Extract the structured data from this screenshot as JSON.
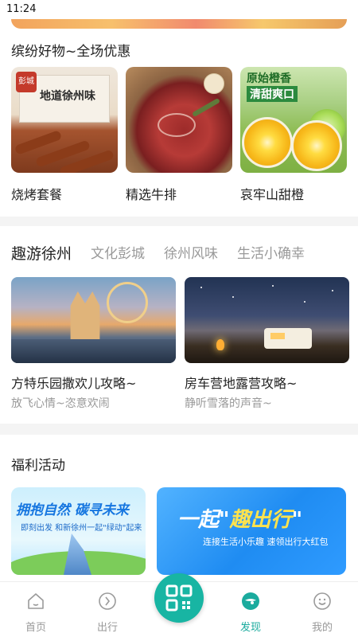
{
  "status_bar": {
    "time": "11:24"
  },
  "goods": {
    "title": "缤纷好物~全场优惠",
    "items": [
      {
        "name": "烧烤套餐",
        "image_text": "地道徐州味",
        "stamp": "彭城"
      },
      {
        "name": "精选牛排"
      },
      {
        "name": "哀牢山甜橙",
        "image_title": "原始橙香",
        "image_sub": "清甜爽口"
      }
    ]
  },
  "tour": {
    "tabs": [
      "趣游徐州",
      "文化彭城",
      "徐州风味",
      "生活小确幸"
    ],
    "active_tab": 0,
    "cards": [
      {
        "title": "方特乐园撒欢儿攻略~",
        "subtitle": "放飞心情~恣意欢闹"
      },
      {
        "title": "房车营地露营攻略~",
        "subtitle": "静听雪落的声音~"
      }
    ]
  },
  "welfare": {
    "title": "福利活动",
    "banners": [
      {
        "title": "拥抱自然 碳寻未来",
        "subtitle": "即刻出发 和新徐州一起\"绿动\"起来"
      },
      {
        "title_pre": "一起\"",
        "title_highlight": "趣出行",
        "title_post": "\"",
        "subtitle": "连接生活小乐趣 速领出行大红包"
      }
    ]
  },
  "bottom_nav": {
    "items": [
      {
        "label": "首页",
        "icon": "home-icon"
      },
      {
        "label": "出行",
        "icon": "compass-icon"
      },
      {
        "label": "发现",
        "icon": "discover-icon"
      },
      {
        "label": "我的",
        "icon": "smile-icon"
      }
    ],
    "active": "发现",
    "center_button_icon": "qr-code-icon"
  },
  "colors": {
    "accent": "#1bab9e",
    "scan_button": "#18b5a3",
    "inactive_text": "#999999"
  }
}
